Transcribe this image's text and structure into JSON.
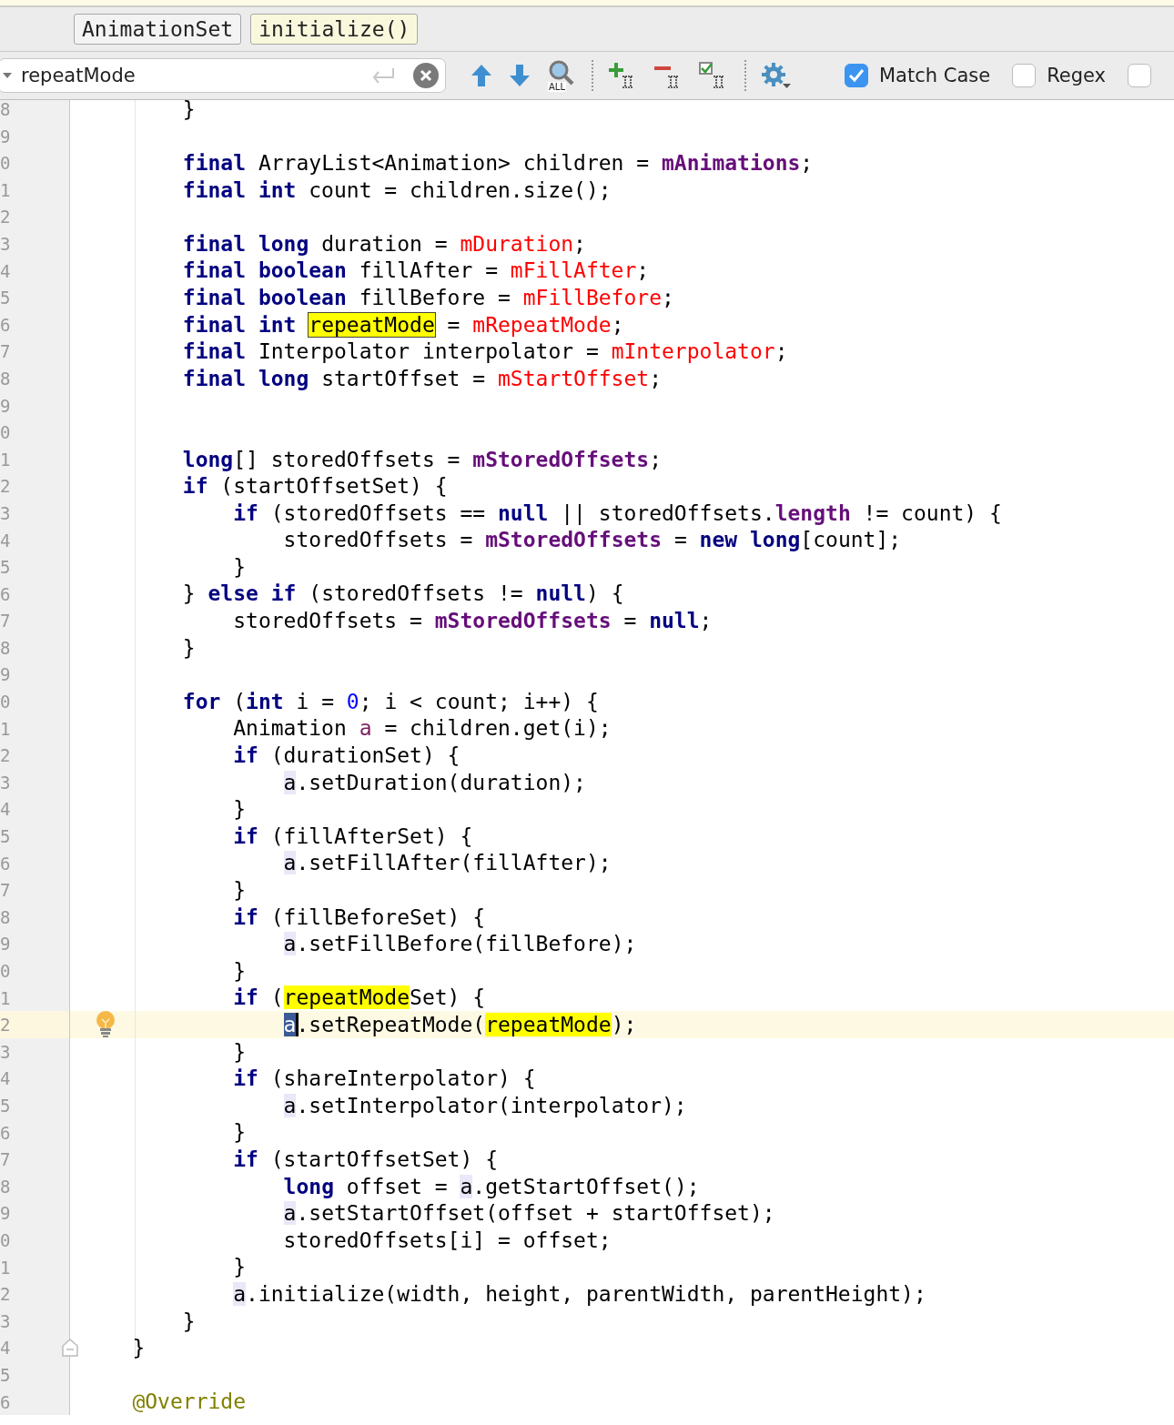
{
  "breadcrumbs": [
    {
      "label": "AnimationSet",
      "selected": false
    },
    {
      "label": "initialize()",
      "selected": true
    }
  ],
  "search": {
    "value": "repeatMode",
    "find_all_badge": "ALL",
    "options": [
      {
        "label": "Match Case",
        "checked": true
      },
      {
        "label": "Regex",
        "checked": false
      },
      {
        "checked": false
      }
    ]
  },
  "editor": {
    "body": [
      {
        "number": "8",
        "current": false,
        "tokens": [
          {
            "kind": "plain",
            "text": "}"
          }
        ]
      },
      {
        "number": "9",
        "current": false
      },
      {
        "number": "0",
        "current": false,
        "tokens": [
          {
            "kind": "keyword",
            "text": "final"
          },
          {
            "kind": "plain",
            "text": " ArrayList<Animation> children = "
          },
          {
            "kind": "field",
            "text": "mAnimations"
          },
          {
            "kind": "plain",
            "text": ";"
          }
        ]
      },
      {
        "number": "1",
        "current": false,
        "tokens": [
          {
            "kind": "keyword",
            "text": "final int"
          },
          {
            "kind": "plain",
            "text": " count = children.size();"
          }
        ]
      },
      {
        "number": "2",
        "current": false
      },
      {
        "number": "3",
        "current": false,
        "tokens": [
          {
            "kind": "keyword",
            "text": "final long"
          },
          {
            "kind": "plain",
            "text": " duration = "
          },
          {
            "kind": "changed",
            "text": "mDuration"
          },
          {
            "kind": "plain",
            "text": ";"
          }
        ]
      },
      {
        "number": "4",
        "current": false,
        "tokens": [
          {
            "kind": "keyword",
            "text": "final boolean"
          },
          {
            "kind": "plain",
            "text": " fillAfter = "
          },
          {
            "kind": "changed",
            "text": "mFillAfter"
          },
          {
            "kind": "plain",
            "text": ";"
          }
        ]
      },
      {
        "number": "5",
        "current": false,
        "tokens": [
          {
            "kind": "keyword",
            "text": "final boolean"
          },
          {
            "kind": "plain",
            "text": " fillBefore = "
          },
          {
            "kind": "changed",
            "text": "mFillBefore"
          },
          {
            "kind": "plain",
            "text": ";"
          }
        ]
      },
      {
        "number": "6",
        "current": false,
        "tokens": [
          {
            "kind": "keyword",
            "text": "final int "
          },
          {
            "kind": "match_current",
            "text": "repeatMode"
          },
          {
            "kind": "plain",
            "text": " = "
          },
          {
            "kind": "changed",
            "text": "mRepeatMode"
          },
          {
            "kind": "plain",
            "text": ";"
          }
        ]
      },
      {
        "number": "7",
        "current": false,
        "tokens": [
          {
            "kind": "keyword",
            "text": "final"
          },
          {
            "kind": "plain",
            "text": " Interpolator interpolator = "
          },
          {
            "kind": "changed",
            "text": "mInterpolator"
          },
          {
            "kind": "plain",
            "text": ";"
          }
        ]
      },
      {
        "number": "8",
        "current": false,
        "tokens": [
          {
            "kind": "keyword",
            "text": "final long"
          },
          {
            "kind": "plain",
            "text": " startOffset = "
          },
          {
            "kind": "changed",
            "text": "mStartOffset"
          },
          {
            "kind": "plain",
            "text": ";"
          }
        ]
      },
      {
        "number": "9",
        "current": false
      },
      {
        "number": "0",
        "current": false
      },
      {
        "number": "1",
        "current": false,
        "tokens": [
          {
            "kind": "keyword",
            "text": "long"
          },
          {
            "kind": "plain",
            "text": "[] storedOffsets = "
          },
          {
            "kind": "field",
            "text": "mStoredOffsets"
          },
          {
            "kind": "plain",
            "text": ";"
          }
        ]
      },
      {
        "number": "2",
        "current": false,
        "tokens": [
          {
            "kind": "keyword",
            "text": "if"
          },
          {
            "kind": "plain",
            "text": " (startOffsetSet) {"
          }
        ],
        "children": [
          {
            "number": "3",
            "current": false,
            "tokens": [
              {
                "kind": "keyword",
                "text": "if"
              },
              {
                "kind": "plain",
                "text": " (storedOffsets == "
              },
              {
                "kind": "keyword",
                "text": "null"
              },
              {
                "kind": "plain",
                "text": " || storedOffsets."
              },
              {
                "kind": "field",
                "text": "length"
              },
              {
                "kind": "plain",
                "text": " != count) {"
              }
            ],
            "children": [
              {
                "number": "4",
                "current": false,
                "tokens": [
                  {
                    "kind": "plain",
                    "text": "storedOffsets = "
                  },
                  {
                    "kind": "field",
                    "text": "mStoredOffsets"
                  },
                  {
                    "kind": "plain",
                    "text": " = "
                  },
                  {
                    "kind": "keyword",
                    "text": "new long"
                  },
                  {
                    "kind": "plain",
                    "text": "[count];"
                  }
                ]
              }
            ]
          },
          {
            "number": "5",
            "current": false,
            "tokens": [
              {
                "kind": "plain",
                "text": "}"
              }
            ]
          }
        ]
      },
      {
        "number": "6",
        "current": false,
        "tokens": [
          {
            "kind": "plain",
            "text": "} "
          },
          {
            "kind": "keyword",
            "text": "else if"
          },
          {
            "kind": "plain",
            "text": " (storedOffsets != "
          },
          {
            "kind": "keyword",
            "text": "null"
          },
          {
            "kind": "plain",
            "text": ") {"
          }
        ],
        "children": [
          {
            "number": "7",
            "current": false,
            "tokens": [
              {
                "kind": "plain",
                "text": "storedOffsets = "
              },
              {
                "kind": "field",
                "text": "mStoredOffsets"
              },
              {
                "kind": "plain",
                "text": " = "
              },
              {
                "kind": "keyword",
                "text": "null"
              },
              {
                "kind": "plain",
                "text": ";"
              }
            ]
          }
        ]
      },
      {
        "number": "8",
        "current": false,
        "tokens": [
          {
            "kind": "plain",
            "text": "}"
          }
        ]
      },
      {
        "number": "9",
        "current": false
      },
      {
        "number": "0",
        "current": false,
        "tokens": [
          {
            "kind": "keyword",
            "text": "for"
          },
          {
            "kind": "plain",
            "text": " ("
          },
          {
            "kind": "keyword",
            "text": "int"
          },
          {
            "kind": "plain",
            "text": " i = "
          },
          {
            "kind": "number",
            "text": "0"
          },
          {
            "kind": "plain",
            "text": "; i < count; i++) {"
          }
        ],
        "children": [
          {
            "number": "1",
            "current": false,
            "tokens": [
              {
                "kind": "plain",
                "text": "Animation "
              },
              {
                "kind": "local",
                "text": "a"
              },
              {
                "kind": "plain",
                "text": " = children.get(i);"
              }
            ]
          },
          {
            "number": "2",
            "current": false,
            "tokens": [
              {
                "kind": "keyword",
                "text": "if"
              },
              {
                "kind": "plain",
                "text": " (durationSet) {"
              }
            ],
            "children": [
              {
                "number": "3",
                "current": false,
                "tokens": [
                  {
                    "kind": "usage",
                    "text": "a"
                  },
                  {
                    "kind": "plain",
                    "text": ".setDuration(duration);"
                  }
                ]
              }
            ]
          },
          {
            "number": "4",
            "current": false,
            "tokens": [
              {
                "kind": "plain",
                "text": "}"
              }
            ]
          },
          {
            "number": "5",
            "current": false,
            "tokens": [
              {
                "kind": "keyword",
                "text": "if"
              },
              {
                "kind": "plain",
                "text": " (fillAfterSet) {"
              }
            ],
            "children": [
              {
                "number": "6",
                "current": false,
                "tokens": [
                  {
                    "kind": "usage",
                    "text": "a"
                  },
                  {
                    "kind": "plain",
                    "text": ".setFillAfter(fillAfter);"
                  }
                ]
              }
            ]
          },
          {
            "number": "7",
            "current": false,
            "tokens": [
              {
                "kind": "plain",
                "text": "}"
              }
            ]
          },
          {
            "number": "8",
            "current": false,
            "tokens": [
              {
                "kind": "keyword",
                "text": "if"
              },
              {
                "kind": "plain",
                "text": " (fillBeforeSet) {"
              }
            ],
            "children": [
              {
                "number": "9",
                "current": false,
                "tokens": [
                  {
                    "kind": "usage",
                    "text": "a"
                  },
                  {
                    "kind": "plain",
                    "text": ".setFillBefore(fillBefore);"
                  }
                ]
              }
            ]
          },
          {
            "number": "0",
            "current": false,
            "tokens": [
              {
                "kind": "plain",
                "text": "}"
              }
            ]
          },
          {
            "number": "1",
            "current": false,
            "tokens": [
              {
                "kind": "keyword",
                "text": "if"
              },
              {
                "kind": "plain",
                "text": " ("
              },
              {
                "kind": "match",
                "text": "repeatMode"
              },
              {
                "kind": "plain",
                "text": "Set) {"
              }
            ],
            "children": [
              {
                "number": "2",
                "current": true,
                "tokens": [
                  {
                    "kind": "caret",
                    "text": "a"
                  },
                  {
                    "kind": "plain",
                    "text": ".setRepeatMode("
                  },
                  {
                    "kind": "match",
                    "text": "repeatMode"
                  },
                  {
                    "kind": "plain",
                    "text": ");"
                  }
                ]
              }
            ]
          },
          {
            "number": "3",
            "current": false,
            "tokens": [
              {
                "kind": "plain",
                "text": "}"
              }
            ]
          },
          {
            "number": "4",
            "current": false,
            "tokens": [
              {
                "kind": "keyword",
                "text": "if"
              },
              {
                "kind": "plain",
                "text": " (shareInterpolator) {"
              }
            ],
            "children": [
              {
                "number": "5",
                "current": false,
                "tokens": [
                  {
                    "kind": "usage",
                    "text": "a"
                  },
                  {
                    "kind": "plain",
                    "text": ".setInterpolator(interpolator);"
                  }
                ]
              }
            ]
          },
          {
            "number": "6",
            "current": false,
            "tokens": [
              {
                "kind": "plain",
                "text": "}"
              }
            ]
          },
          {
            "number": "7",
            "current": false,
            "tokens": [
              {
                "kind": "keyword",
                "text": "if"
              },
              {
                "kind": "plain",
                "text": " (startOffsetSet) {"
              }
            ],
            "children": [
              {
                "number": "8",
                "current": false,
                "tokens": [
                  {
                    "kind": "keyword",
                    "text": "long"
                  },
                  {
                    "kind": "plain",
                    "text": " offset = "
                  },
                  {
                    "kind": "usage",
                    "text": "a"
                  },
                  {
                    "kind": "plain",
                    "text": ".getStartOffset();"
                  }
                ]
              },
              {
                "number": "9",
                "current": false,
                "tokens": [
                  {
                    "kind": "usage",
                    "text": "a"
                  },
                  {
                    "kind": "plain",
                    "text": ".setStartOffset(offset + startOffset);"
                  }
                ]
              },
              {
                "number": "0",
                "current": false,
                "tokens": [
                  {
                    "kind": "plain",
                    "text": "storedOffsets[i] = offset;"
                  }
                ]
              }
            ]
          },
          {
            "number": "1",
            "current": false,
            "tokens": [
              {
                "kind": "plain",
                "text": "}"
              }
            ]
          },
          {
            "number": "2",
            "current": false,
            "tokens": [
              {
                "kind": "usage",
                "text": "a"
              },
              {
                "kind": "plain",
                "text": ".initialize(width, height, parentWidth, parentHeight);"
              }
            ]
          }
        ]
      },
      {
        "number": "3",
        "current": false,
        "tokens": [
          {
            "kind": "plain",
            "text": "}"
          }
        ]
      }
    ],
    "lines": [
      {
        "number": "4",
        "fold": true,
        "tokens": [
          {
            "kind": "plain",
            "text": "}"
          }
        ]
      },
      {
        "number": "5",
        "fold": false
      },
      {
        "number": "6",
        "fold": false,
        "tokens": [
          {
            "kind": "annotation",
            "text": "@Override"
          }
        ]
      }
    ]
  }
}
